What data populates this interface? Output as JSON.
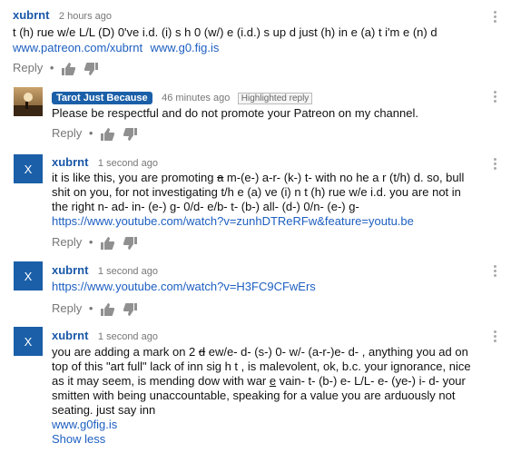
{
  "comments": [
    {
      "author": "xubrnt",
      "time": "2 hours ago",
      "text": "t (h) rue w/e L/L (D) 0've i.d. (i) s h 0 (w/) e (i.d.) s up d just (h) in e (a) t i'm e (n) d",
      "links": [
        "www.patreon.com/xubrnt",
        "www.g0.fig.is"
      ],
      "reply": "Reply"
    },
    {
      "author": "Tarot Just Because",
      "time": "46 minutes ago",
      "highlight": "Highlighted reply",
      "text": "Please be respectful and do not promote your Patreon on my channel.",
      "reply": "Reply"
    },
    {
      "author": "xubrnt",
      "avatar": "X",
      "time": "1 second ago",
      "text_parts": [
        "it is like this, you are promoting ",
        "a",
        " m-(e-) a-r- (k-) t-  with no he a r (t/h) d.  so, bull shit on you, for not investigating  t/h e (a) ve (i) n t (h) rue w/e i.d.  you are not in the right  n- ad- in- (e-) g- 0/d- e/b- t- (b-) all- (d-) 0/n- (e-) g-"
      ],
      "links": [
        "https://www.youtube.com/watch?v=zunhDTReRFw&feature=youtu.be"
      ],
      "reply": "Reply"
    },
    {
      "author": "xubrnt",
      "avatar": "X",
      "time": "1 second ago",
      "links": [
        "https://www.youtube.com/watch?v=H3FC9CFwErs"
      ],
      "reply": "Reply"
    },
    {
      "author": "xubrnt",
      "avatar": "X",
      "time": "1 second ago",
      "text_parts": [
        "you are adding a mark on 2 ",
        "d",
        " ew/e- d- (s-) 0- w/- (a-r-)e- d- , anything you ad on top of this \"art full\" lack of inn sig h t , is malevolent, ok, b.c. your ignorance, nice as it may seem, is mending dow with war ",
        "e",
        " vain- t- (b-) e- L/L- e- (ye-) i- d-   your smitten with being unaccountable, speaking for a value you are arduously not seating.  just say inn"
      ],
      "links": [
        "www.g0fig.is"
      ],
      "show_less": "Show less"
    }
  ],
  "separator": "•"
}
